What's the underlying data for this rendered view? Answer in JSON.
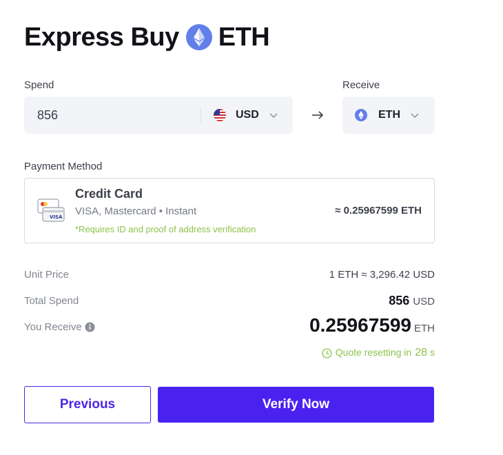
{
  "header": {
    "title_prefix": "Express Buy",
    "title_asset": "ETH",
    "asset_icon": "ethereum-icon"
  },
  "spend": {
    "label": "Spend",
    "value": "856",
    "currency": "USD",
    "currency_icon": "us-flag-icon"
  },
  "receive": {
    "label": "Receive",
    "currency": "ETH",
    "currency_icon": "ethereum-icon"
  },
  "payment": {
    "label": "Payment Method",
    "method_title": "Credit Card",
    "method_subtitle": "VISA, Mastercard • Instant",
    "note": "*Requires ID and proof of address verification",
    "estimate": "≈ 0.25967599 ETH",
    "icon_text": "VISA"
  },
  "summary": {
    "unit_price_label": "Unit Price",
    "unit_price_value": "1 ETH ≈ 3,296.42 USD",
    "total_spend_label": "Total Spend",
    "total_spend_amount": "856",
    "total_spend_unit": "USD",
    "receive_label": "You Receive",
    "receive_amount": "0.25967599",
    "receive_unit": "ETH",
    "quote_prefix": "Quote resetting in",
    "quote_seconds": "28",
    "quote_suffix": "s"
  },
  "actions": {
    "previous_label": "Previous",
    "verify_label": "Verify Now"
  },
  "colors": {
    "primary": "#4a22f0",
    "accent_green": "#8bc34a",
    "eth": "#627eea",
    "input_bg": "#f2f4f8"
  }
}
